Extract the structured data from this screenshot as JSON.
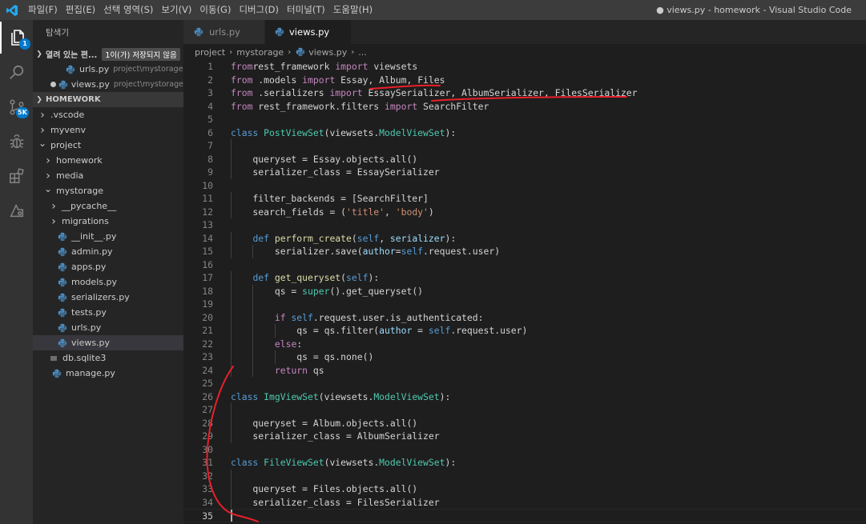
{
  "titlebar": {
    "menu": [
      "파일(F)",
      "편집(E)",
      "선택 영역(S)",
      "보기(V)",
      "이동(G)",
      "디버그(D)",
      "터미널(T)",
      "도움말(H)"
    ],
    "window_title": "● views.py - homework - Visual Studio Code"
  },
  "activitybar": {
    "explorer_badge": "1",
    "scm_badge": "5K"
  },
  "sidebar": {
    "title": "탐색기",
    "open_editors_label": "열려 있는 편...",
    "open_editors_note": "1이(가) 저장되지 않음",
    "open_editors": [
      {
        "name": "urls.py",
        "path": "project\\mystorage"
      },
      {
        "name": "views.py",
        "path": "project\\mystorage"
      }
    ],
    "workspace_label": "HOMEWORK",
    "tree": [
      {
        "label": ".vscode",
        "kind": "folder",
        "open": false
      },
      {
        "label": "myvenv",
        "kind": "folder",
        "open": false
      },
      {
        "label": "project",
        "kind": "folder",
        "open": true
      },
      {
        "label": "homework",
        "kind": "folder",
        "open": false
      },
      {
        "label": "media",
        "kind": "folder",
        "open": false
      },
      {
        "label": "mystorage",
        "kind": "folder",
        "open": true
      },
      {
        "label": "__pycache__",
        "kind": "folder",
        "open": false
      },
      {
        "label": "migrations",
        "kind": "folder",
        "open": false
      },
      {
        "label": "__init__.py",
        "kind": "py"
      },
      {
        "label": "admin.py",
        "kind": "py"
      },
      {
        "label": "apps.py",
        "kind": "py"
      },
      {
        "label": "models.py",
        "kind": "py"
      },
      {
        "label": "serializers.py",
        "kind": "py"
      },
      {
        "label": "tests.py",
        "kind": "py"
      },
      {
        "label": "urls.py",
        "kind": "py"
      },
      {
        "label": "views.py",
        "kind": "py",
        "selected": true
      },
      {
        "label": "db.sqlite3",
        "kind": "db"
      },
      {
        "label": "manage.py",
        "kind": "py"
      }
    ]
  },
  "editor": {
    "tabs": [
      {
        "label": "urls.py",
        "active": false
      },
      {
        "label": "views.py",
        "active": true,
        "dirty": true
      }
    ],
    "breadcrumb": [
      "project",
      "mystorage",
      "views.py",
      "..."
    ],
    "current_line": 35,
    "lines": [
      [
        [
          "kwc",
          "from"
        ],
        [
          "",
          "rest_framework "
        ],
        [
          "kwc",
          "import"
        ],
        [
          "",
          " viewsets"
        ]
      ],
      [
        [
          "kwc",
          "from"
        ],
        [
          "",
          " .models "
        ],
        [
          "kwc",
          "import"
        ],
        [
          "",
          " Essay, Album, Files"
        ]
      ],
      [
        [
          "kwc",
          "from"
        ],
        [
          "",
          " .serializers "
        ],
        [
          "kwc",
          "import"
        ],
        [
          "",
          " EssaySerializer, AlbumSerializer, FilesSerializer"
        ]
      ],
      [
        [
          "kwc",
          "from"
        ],
        [
          "",
          " rest_framework.filters "
        ],
        [
          "kwc",
          "import"
        ],
        [
          "",
          " SearchFilter"
        ]
      ],
      [],
      [
        [
          "kw",
          "class"
        ],
        [
          "",
          " "
        ],
        [
          "cls",
          "PostViewSet"
        ],
        [
          "",
          "(viewsets."
        ],
        [
          "cls",
          "ModelViewSet"
        ],
        [
          "",
          "):"
        ]
      ],
      [],
      [
        [
          "",
          "    queryset = Essay.objects.all()"
        ]
      ],
      [
        [
          "",
          "    serializer_class = EssaySerializer"
        ]
      ],
      [],
      [
        [
          "",
          "    filter_backends = [SearchFilter]"
        ]
      ],
      [
        [
          "",
          "    search_fields = ("
        ],
        [
          "str",
          "'title'"
        ],
        [
          "",
          ", "
        ],
        [
          "str",
          "'body'"
        ],
        [
          "",
          ")"
        ]
      ],
      [],
      [
        [
          "",
          "    "
        ],
        [
          "kw",
          "def"
        ],
        [
          "",
          " "
        ],
        [
          "fn",
          "perform_create"
        ],
        [
          "",
          "("
        ],
        [
          "self",
          "self"
        ],
        [
          "",
          ", "
        ],
        [
          "var",
          "serializer"
        ],
        [
          "",
          "):"
        ]
      ],
      [
        [
          "",
          "        serializer.save("
        ],
        [
          "var",
          "author"
        ],
        [
          "",
          "="
        ],
        [
          "self",
          "self"
        ],
        [
          "",
          ".request.user)"
        ]
      ],
      [],
      [
        [
          "",
          "    "
        ],
        [
          "kw",
          "def"
        ],
        [
          "",
          " "
        ],
        [
          "fn",
          "get_queryset"
        ],
        [
          "",
          "("
        ],
        [
          "self",
          "self"
        ],
        [
          "",
          "):"
        ]
      ],
      [
        [
          "",
          "        qs = "
        ],
        [
          "cls",
          "super"
        ],
        [
          "",
          "().get_queryset()"
        ]
      ],
      [],
      [
        [
          "",
          "        "
        ],
        [
          "kwc",
          "if"
        ],
        [
          "",
          " "
        ],
        [
          "self",
          "self"
        ],
        [
          "",
          ".request.user.is_authenticated:"
        ]
      ],
      [
        [
          "",
          "            qs = qs.filter("
        ],
        [
          "var",
          "author"
        ],
        [
          "",
          " = "
        ],
        [
          "self",
          "self"
        ],
        [
          "",
          ".request.user)"
        ]
      ],
      [
        [
          "",
          "        "
        ],
        [
          "kwc",
          "else"
        ],
        [
          "",
          ":"
        ]
      ],
      [
        [
          "",
          "            qs = qs.none()"
        ]
      ],
      [
        [
          "",
          "        "
        ],
        [
          "kwc",
          "return"
        ],
        [
          "",
          " qs"
        ]
      ],
      [],
      [
        [
          "kw",
          "class"
        ],
        [
          "",
          " "
        ],
        [
          "cls",
          "ImgViewSet"
        ],
        [
          "",
          "(viewsets."
        ],
        [
          "cls",
          "ModelViewSet"
        ],
        [
          "",
          "):"
        ]
      ],
      [],
      [
        [
          "",
          "    queryset = Album.objects.all()"
        ]
      ],
      [
        [
          "",
          "    serializer_class = AlbumSerializer"
        ]
      ],
      [],
      [
        [
          "kw",
          "class"
        ],
        [
          "",
          " "
        ],
        [
          "cls",
          "FileViewSet"
        ],
        [
          "",
          "(viewsets."
        ],
        [
          "cls",
          "ModelViewSet"
        ],
        [
          "",
          "):"
        ]
      ],
      [],
      [
        [
          "",
          "    queryset = Files.objects.all()"
        ]
      ],
      [
        [
          "",
          "    serializer_class = FilesSerializer"
        ]
      ],
      []
    ]
  },
  "colors": {
    "accent": "#007acc",
    "annotation": "#e8202a"
  },
  "icons": {
    "logo": "vscode-logo-icon",
    "python": "python-file-icon",
    "folder_chevron": "chevron-right-icon"
  }
}
